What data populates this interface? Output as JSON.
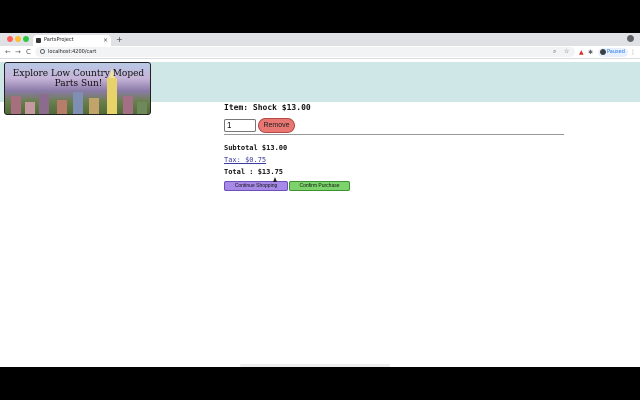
{
  "browser": {
    "tab_title": "PartsProject",
    "tab_close": "×",
    "new_tab": "+",
    "url": "localhost:4200/cart",
    "back": "←",
    "forward": "→",
    "reload": "C",
    "profile_status": "Paused",
    "icons": [
      "site-info-icon",
      "zoom-icon",
      "bookmark-star-icon",
      "extension-icon",
      "puzzle-icon",
      "profile-avatar-icon",
      "kebab-menu-icon"
    ]
  },
  "banner": {
    "title": "Explore Low Country Moped Parts Sun!"
  },
  "cart": {
    "item_line": "Item: Shock $13.00",
    "quantity_value": "1",
    "remove_label": "Remove",
    "subtotal": "Subtotal $13.00",
    "tax": "Tax: $0.75",
    "total": "Total : $13.75",
    "continue_label": "Continue Shopping",
    "confirm_label": "Confirm Purchase"
  },
  "colors": {
    "header_band": "#cfe7e6",
    "remove_button": "#e87672",
    "continue_button": "#a78ae8",
    "confirm_button": "#7dd36b"
  }
}
